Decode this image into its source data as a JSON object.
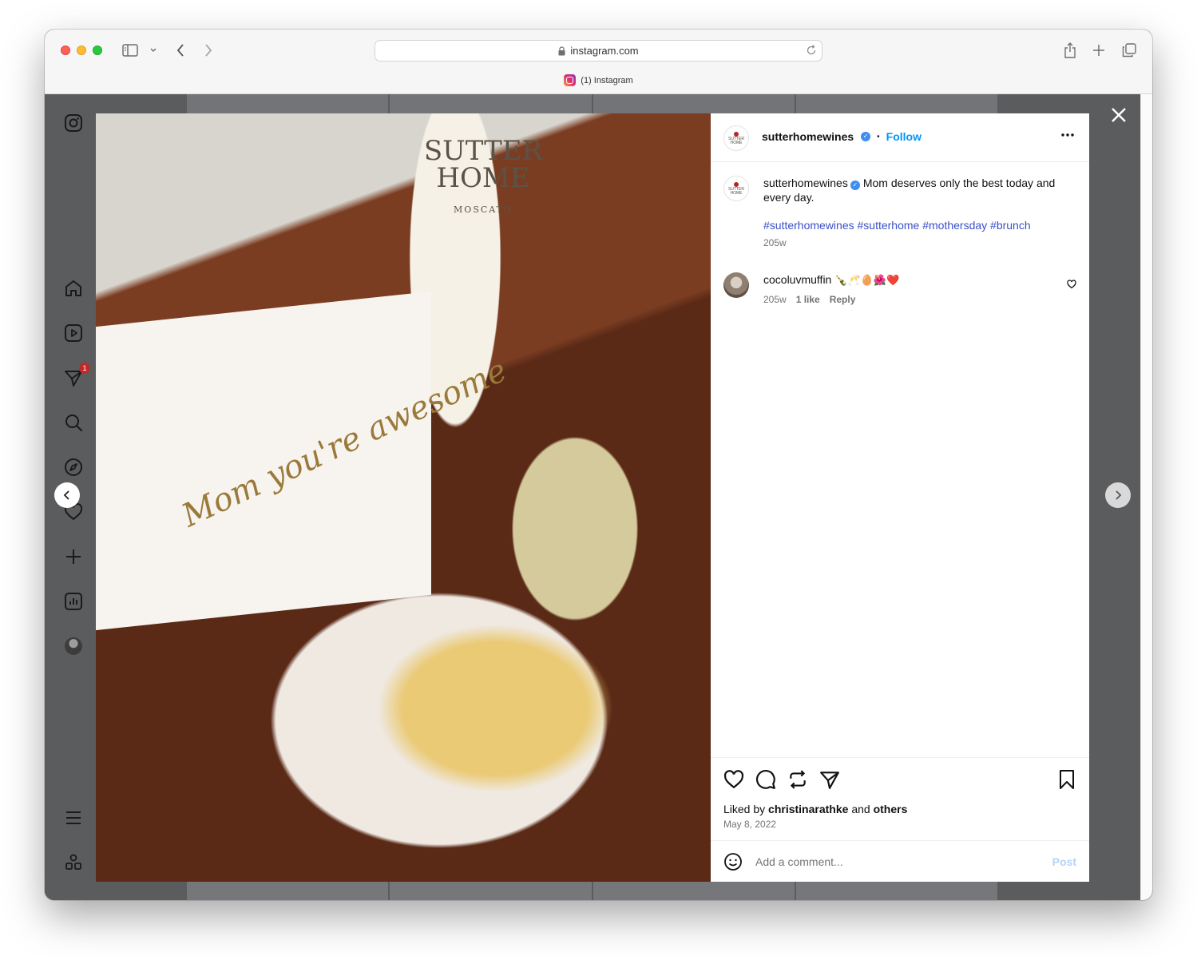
{
  "browser": {
    "url": "instagram.com",
    "tab_title": "(1) Instagram"
  },
  "nav": {
    "notification_count": "1"
  },
  "post": {
    "author": "sutterhomewines",
    "follow_label": "Follow",
    "separator": "•",
    "caption": "Mom deserves only the best today and every day.",
    "hashtags": "#sutterhomewines #sutterhome #mothersday #brunch",
    "caption_age": "205w",
    "logo_text_1": "SUTTER",
    "logo_text_2": "HOME",
    "image_label_1": "SUTTER",
    "image_label_2": "HOME",
    "image_label_3": "MOSCATO",
    "card_text": "Mom you're awesome",
    "comments": [
      {
        "username": "cocoluvmuffin",
        "text": "🍾🥂🥚🌺❤️",
        "age": "205w",
        "likes": "1 like",
        "reply_label": "Reply"
      }
    ],
    "liked_by_prefix": "Liked by",
    "liked_by_user": "christinarathke",
    "liked_by_and": "and",
    "liked_by_others": "others",
    "date": "May 8, 2022",
    "comment_placeholder": "Add a comment...",
    "post_label": "Post"
  },
  "colors": {
    "link_blue": "#0095f6",
    "hashtag": "#00376b",
    "verified": "#3d8ef0"
  }
}
